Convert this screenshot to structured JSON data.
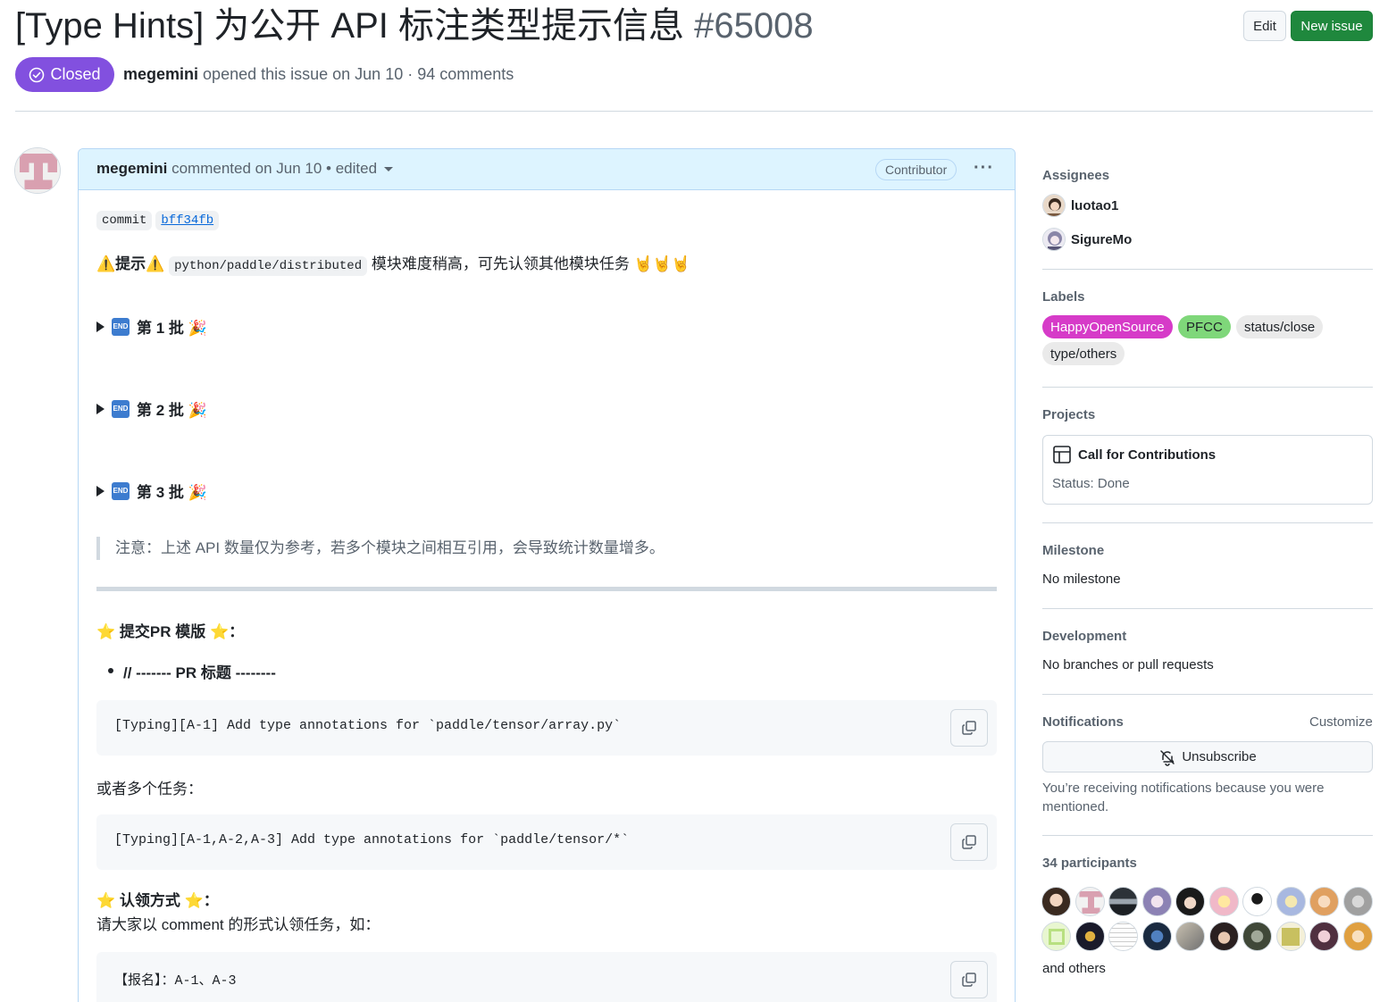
{
  "header": {
    "title": "[Type Hints] 为公开 API 标注类型提示信息",
    "number": "#65008",
    "edit_label": "Edit",
    "new_issue_label": "New issue",
    "state": "Closed",
    "author": "megemini",
    "meta_text": "opened this issue on Jun 10 · 94 comments"
  },
  "comment": {
    "author": "megemini",
    "meta": "commented on Jun 10 • edited",
    "role_badge": "Contributor",
    "more_label": "···",
    "commit_word": "commit",
    "commit_hash": "bff34fb",
    "hint_prefix": "⚠️提示⚠️",
    "hint_code": "python/paddle/distributed",
    "hint_text": "模块难度稍高，可先认领其他模块任务 🤘🤘🤘",
    "end_icon_text": "END",
    "batches": [
      {
        "label": "第 1 批 🎉"
      },
      {
        "label": "第 2 批 🎉"
      },
      {
        "label": "第 3 批 🎉"
      }
    ],
    "note": "注意：上述 API 数量仅为参考，若多个模块之间相互引用，会导致统计数量增多。",
    "pr_template_heading": "⭐️ 提交PR 模版 ⭐️：",
    "pr_title_bullet": "// ------- PR 标题 --------",
    "code1": "[Typing][A-1] Add type annotations for `paddle/tensor/array.py`",
    "or_multiple": "或者多个任务：",
    "code2": "[Typing][A-1,A-2,A-3] Add type annotations for `paddle/tensor/*`",
    "claim_heading": "⭐️ 认领方式 ⭐️：",
    "claim_text": "请大家以 comment 的形式认领任务，如：",
    "code3": "【报名】：A-1、A-3"
  },
  "sidebar": {
    "assignees_heading": "Assignees",
    "assignees": [
      "luotao1",
      "SigureMo"
    ],
    "labels_heading": "Labels",
    "labels": [
      {
        "name": "HappyOpenSource",
        "bg": "#d63bc8",
        "fg": "#ffffff"
      },
      {
        "name": "PFCC",
        "bg": "#7fd77a",
        "fg": "#1f2328"
      },
      {
        "name": "status/close",
        "bg": "#eaeaea",
        "fg": "#1f2328"
      },
      {
        "name": "type/others",
        "bg": "#eaeaea",
        "fg": "#1f2328"
      }
    ],
    "projects_heading": "Projects",
    "project_name": "Call for Contributions",
    "project_status": "Status: Done",
    "milestone_heading": "Milestone",
    "milestone_value": "No milestone",
    "development_heading": "Development",
    "development_value": "No branches or pull requests",
    "notifications_heading": "Notifications",
    "customize_label": "Customize",
    "unsubscribe_label": "Unsubscribe",
    "notif_reason": "You’re receiving notifications because you were mentioned.",
    "participants_heading": "34 participants",
    "and_others": "and others"
  },
  "colors": {
    "accent_green": "#1f883d",
    "closed_purple": "#8250df",
    "link_blue": "#0969da"
  }
}
